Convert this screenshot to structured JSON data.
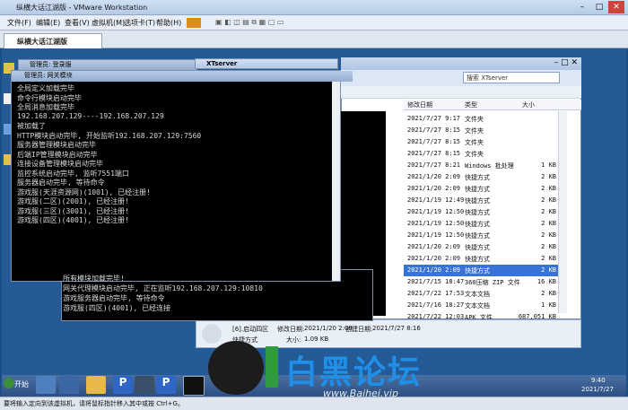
{
  "vmware": {
    "title": "纵横大话江湖版 - VMware Workstation",
    "menu": [
      "文件(F)",
      "编辑(E)",
      "查看(V)",
      "虚拟机(M)",
      "选项卡(T)",
      "帮助(H)"
    ],
    "tab": "纵横大话江湖版",
    "status_hint": "要将输入定向到该虚拟机，请将鼠标指针移入其中或按 Ctrl+G。"
  },
  "explorer": {
    "title": "XTserver",
    "search_placeholder": "搜索 XTserver",
    "columns": {
      "date": "修改日期",
      "type": "类型",
      "size": "大小"
    },
    "files": [
      {
        "date": "2021/7/27 9:17",
        "type": "文件夹",
        "size": ""
      },
      {
        "date": "2021/7/27 8:15",
        "type": "文件夹",
        "size": ""
      },
      {
        "date": "2021/7/27 8:15",
        "type": "文件夹",
        "size": ""
      },
      {
        "date": "2021/7/27 8:15",
        "type": "文件夹",
        "size": ""
      },
      {
        "date": "2021/7/27 8:21",
        "type": "Windows 批处理",
        "size": "1 KB"
      },
      {
        "date": "2021/1/20 2:09",
        "type": "快捷方式",
        "size": "2 KB"
      },
      {
        "date": "2021/1/20 2:09",
        "type": "快捷方式",
        "size": "2 KB"
      },
      {
        "date": "2021/1/19 12:49",
        "type": "快捷方式",
        "size": "2 KB"
      },
      {
        "date": "2021/1/19 12:50",
        "type": "快捷方式",
        "size": "2 KB"
      },
      {
        "date": "2021/1/19 12:50",
        "type": "快捷方式",
        "size": "2 KB"
      },
      {
        "date": "2021/1/19 12:50",
        "type": "快捷方式",
        "size": "2 KB"
      },
      {
        "date": "2021/1/20 2:09",
        "type": "快捷方式",
        "size": "2 KB"
      },
      {
        "date": "2021/1/20 2:09",
        "type": "快捷方式",
        "size": "2 KB"
      },
      {
        "date": "2021/1/20 2:09",
        "type": "快捷方式",
        "size": "2 KB"
      },
      {
        "date": "2021/7/15 18:47",
        "type": "360压缩 ZIP 文件",
        "size": "16 KB"
      },
      {
        "date": "2021/7/22 17:53",
        "type": "文本文档",
        "size": "2 KB"
      },
      {
        "date": "2021/7/16 18:27",
        "type": "文本文档",
        "size": "1 KB"
      },
      {
        "date": "2021/7/22 12:03",
        "type": "APK 文件",
        "size": "687,051 KB"
      }
    ],
    "selected_index": 13,
    "details": {
      "name": "[6].启动四区",
      "modified_label": "修改日期:",
      "modified": "2021/1/20 2:09",
      "created_label": "创建日期:",
      "created": "2021/7/27 8:16",
      "kind": "快捷方式",
      "size_label": "大小:",
      "size": "1.09 KB"
    }
  },
  "cmd": {
    "back_title": "管理员: 登录服",
    "front_title": "管理员:  网关模块",
    "middle_title": "XTserver",
    "lines": [
      "全局定义加载完毕",
      "命令行模块启动完毕",
      "全局消息加载完毕",
      "192.168.207.129----192.168.207.129",
      "被加载了",
      "HTTP模块启动完毕, 开始监听192.168.207.129:7560",
      "服务器管理模块启动完毕",
      "后端IP管理模块启动完毕",
      "连接设备管理模块启动完毕",
      "监控系统启动完毕, 监听7551端口",
      "服务器启动完毕, 等待命令",
      "游戏服(天涯资源网)(1001), 已经注册!",
      "游戏服(二区)(2001), 已经注册!",
      "游戏服(三区)(3001), 已经注册!",
      "游戏服(四区)(4001), 已经注册!"
    ],
    "back_lines": [
      "所有模块加载完毕!",
      "网关代理模块启动完毕, 正在监听192.168.207.129:10810",
      "游戏服务器启动完毕, 等待命令",
      "游戏服(四区)(4001), 已经连接"
    ]
  },
  "taskbar": {
    "start": "开始",
    "time": "9:40",
    "date": "2021/7/27"
  },
  "watermark": {
    "text": "白黑论坛",
    "url": "www.Baihei.vip"
  }
}
